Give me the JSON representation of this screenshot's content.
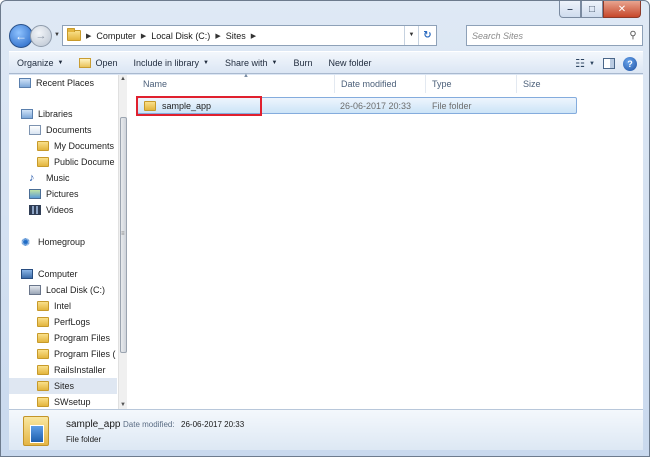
{
  "address": {
    "crumbs": [
      "Computer",
      "Local Disk (C:)",
      "Sites"
    ]
  },
  "search": {
    "placeholder": "Search Sites"
  },
  "toolbar": {
    "organize": "Organize",
    "open": "Open",
    "include_in_library": "Include in library",
    "share_with": "Share with",
    "burn": "Burn",
    "new_folder": "New folder"
  },
  "nav": {
    "recent_places": "Recent Places",
    "libraries": "Libraries",
    "documents": "Documents",
    "my_documents": "My Documents",
    "public_documents": "Public Docume",
    "music": "Music",
    "pictures": "Pictures",
    "videos": "Videos",
    "homegroup": "Homegroup",
    "computer": "Computer",
    "local_disk": "Local Disk (C:)",
    "intel": "Intel",
    "perflogs": "PerfLogs",
    "program_files": "Program Files",
    "program_files_x86": "Program Files (",
    "railsinstaller": "RailsInstaller",
    "sites": "Sites",
    "swsetup": "SWsetup"
  },
  "columns": {
    "name": "Name",
    "date_modified": "Date modified",
    "type": "Type",
    "size": "Size"
  },
  "files": [
    {
      "name": "sample_app",
      "date_modified": "26-06-2017 20:33",
      "type": "File folder",
      "size": ""
    }
  ],
  "details": {
    "name": "sample_app",
    "date_label": "Date modified:",
    "date_value": "26-06-2017 20:33",
    "type": "File folder"
  },
  "colors": {
    "selection": "#cce4f7",
    "highlight_box": "#e0202e",
    "frame": "#c9d9ee"
  }
}
